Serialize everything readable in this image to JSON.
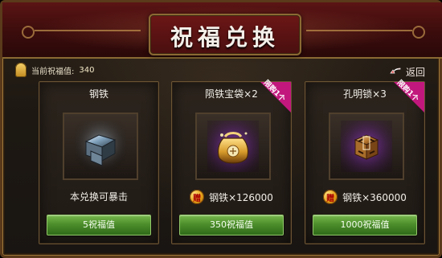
{
  "header": {
    "title": "祝福兑换"
  },
  "blessing": {
    "label": "当前祝福值:",
    "value": "340"
  },
  "back": {
    "label": "返回"
  },
  "cards": [
    {
      "name": "钢铁",
      "description": "本兑换可暴击",
      "gift_label": "",
      "cost_button": "5祝福值",
      "limited_tag": ""
    },
    {
      "name": "陨铁宝袋×2",
      "description": "",
      "gift_label": "钢铁×126000",
      "cost_button": "350祝福值",
      "limited_tag": "限购1个"
    },
    {
      "name": "孔明锁×3",
      "description": "",
      "gift_label": "钢铁×360000",
      "cost_button": "1000祝福值",
      "limited_tag": "限购1个"
    }
  ],
  "gift_badge": {
    "text": "赠"
  },
  "icons": {
    "bell": "bell-icon",
    "back": "back-arrow-icon",
    "steel": "steel-ingot-icon",
    "bag": "treasure-bag-icon",
    "lock": "kongming-lock-icon",
    "gift": "gift-badge-icon"
  },
  "colors": {
    "header_red": "#5b1414",
    "gold_border": "#8b6a33",
    "button_green": "#4d8e2c",
    "limited_magenta": "#c2187d"
  }
}
